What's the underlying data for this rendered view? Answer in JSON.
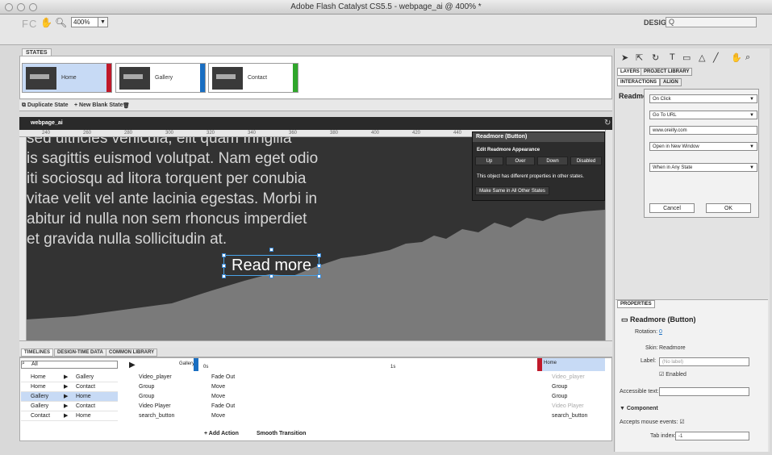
{
  "window": {
    "title": "Adobe Flash Catalyst CS5.5 - webpage_ai @ 400% *"
  },
  "toolbar": {
    "logo": "FC",
    "zoom": "400%",
    "workspace": "DESIGN",
    "search": "Q"
  },
  "states": {
    "label": "STATES",
    "items": [
      {
        "name": "Home",
        "color": "#c0192a"
      },
      {
        "name": "Gallery",
        "color": "#1a6fc2"
      },
      {
        "name": "Contact",
        "color": "#2fa62b"
      }
    ],
    "duplicate": "Duplicate State",
    "new_blank": "New Blank State"
  },
  "canvas": {
    "title": "webpage_ai",
    "ruler": [
      "240",
      "260",
      "280",
      "300",
      "320",
      "340",
      "360",
      "380",
      "400",
      "420",
      "440"
    ],
    "body_lines": [
      "sed ultricies vehicula, elit quam fringilla",
      "is sagittis euismod volutpat. Nam eget odio",
      "iti sociosqu ad litora torquent per conubia",
      " vitae velit vel ante lacinia egestas. Morbi in",
      "abitur id nulla non sem rhoncus imperdiet",
      "et gravida nulla sollicitudin at."
    ],
    "button_text": "Read more"
  },
  "popup": {
    "title": "Readmore (Button)",
    "edit": "Edit Readmore Appearance",
    "states": [
      "Up",
      "Over",
      "Down",
      "Disabled"
    ],
    "note": "This object has different properties in other states.",
    "make_same": "Make Same in All Other States"
  },
  "bottom": {
    "tabs": [
      "TIMELINES",
      "DESIGN-TIME DATA",
      "COMMON LIBRARY"
    ],
    "filter": "All",
    "transitions": [
      {
        "from": "Home",
        "to": "Gallery"
      },
      {
        "from": "Home",
        "to": "Contact"
      },
      {
        "from": "Gallery",
        "to": "Home"
      },
      {
        "from": "Gallery",
        "to": "Contact"
      },
      {
        "from": "Contact",
        "to": "Home"
      }
    ],
    "target_state": "Gallery",
    "layers": [
      "Video_player",
      "Group",
      "Group",
      "Video Player",
      "search_button"
    ],
    "actions": [
      "Fade Out",
      "Move",
      "Move",
      "Fade Out",
      "Move"
    ],
    "time_start": "0s",
    "time_mid": "1s",
    "right_state": "Home",
    "right_layers": [
      "Video_player",
      "Group",
      "Group",
      "Video Player",
      "search_button"
    ],
    "add_action": "Add Action",
    "smooth": "Smooth Transition"
  },
  "right": {
    "tabs": [
      "LAYERS",
      "PROJECT LIBRARY"
    ],
    "sub_tabs": [
      "INTERACTIONS",
      "ALIGN"
    ],
    "heading": "Readmo",
    "interaction": {
      "event": "On Click",
      "action": "Go To URL",
      "url": "www.oreilly.com",
      "target": "Open in New Window",
      "condition": "When in Any State",
      "cancel": "Cancel",
      "ok": "OK"
    }
  },
  "properties": {
    "tab": "PROPERTIES",
    "title": "Readmore (Button)",
    "rotation_label": "Rotation:",
    "rotation": "0",
    "skin_label": "Skin:",
    "skin": "Readmore",
    "label_label": "Label:",
    "label_placeholder": "(No label)",
    "enabled": "Enabled",
    "accessible": "Accessible text:",
    "component": "Component",
    "mouse": "Accepts mouse events:",
    "tab_index_label": "Tab index:",
    "tab_index": "-1"
  }
}
